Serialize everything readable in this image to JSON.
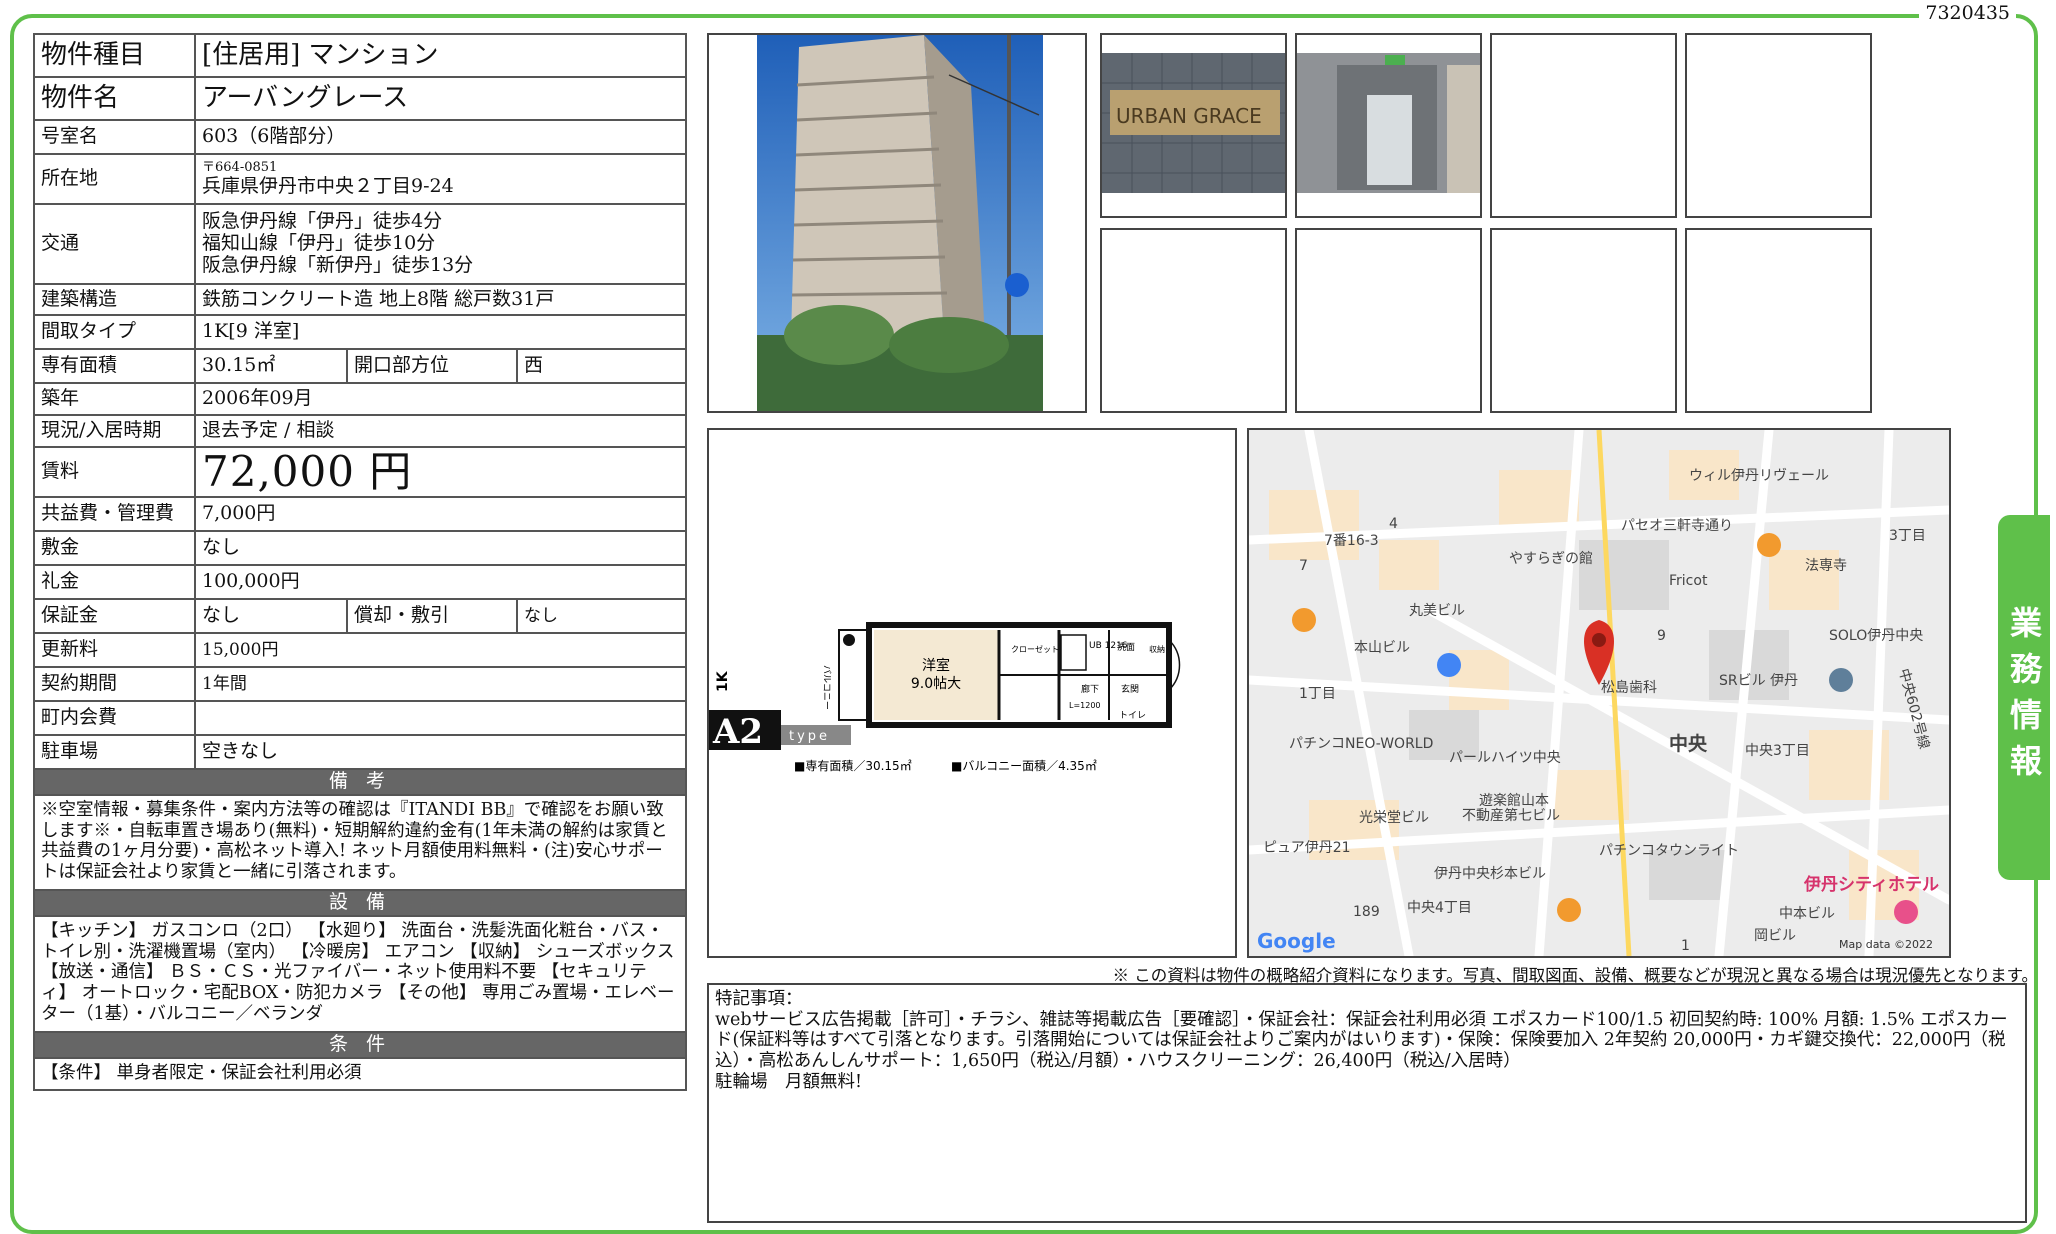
{
  "doc_id": "7320435",
  "side_tab": "業務情報",
  "property": {
    "type_label": "物件種目",
    "type_value": "[住居用]  マンション",
    "name_label": "物件名",
    "name_value": "アーバングレース",
    "room_label": "号室名",
    "room_value": "603（6階部分）",
    "address_label": "所在地",
    "postal": "〒664-0851",
    "address": "兵庫県伊丹市中央２丁目9-24",
    "access_label": "交通",
    "access": [
      "阪急伊丹線「伊丹」徒歩4分",
      "福知山線「伊丹」徒歩10分",
      "阪急伊丹線「新伊丹」徒歩13分"
    ],
    "structure_label": "建築構造",
    "structure_value": "鉄筋コンクリート造 地上8階 総戸数31戸",
    "layout_label": "間取タイプ",
    "layout_value": "1K[9 洋室]",
    "area_label": "専有面積",
    "area_value": "30.15㎡",
    "direction_label": "開口部方位",
    "direction_value": "西",
    "built_label": "築年",
    "built_value": "2006年09月",
    "status_label": "現況/入居時期",
    "status_value": "退去予定 / 相談",
    "rent_label": "賃料",
    "rent_value": "72,000 円",
    "fee_label": "共益費・管理費",
    "fee_value": "7,000円",
    "deposit_label": "敷金",
    "deposit_value": "なし",
    "key_money_label": "礼金",
    "key_money_value": "100,000円",
    "guarantee_label": "保証金",
    "guarantee_value": "なし",
    "amort_label": "償却・敷引",
    "amort_value": "なし",
    "renewal_label": "更新料",
    "renewal_value": "15,000円",
    "term_label": "契約期間",
    "term_value": "1年間",
    "town_fee_label": "町内会費",
    "town_fee_value": "",
    "parking_label": "駐車場",
    "parking_value": "空きなし"
  },
  "remarks": {
    "title": "備 考",
    "text": "※空室情報・募集条件・案内方法等の確認は『ITANDI BB』で確認をお願い致します※・自転車置き場あり(無料)・短期解約違約金有(1年未満の解約は家賃と共益費の1ヶ月分要)・高松ネット導入! ネット月額使用料無料・(注)安心サポートは保証会社より家賃と一緒に引落されます。"
  },
  "equipment": {
    "title": "設 備",
    "text": "【キッチン】 ガスコンロ（2口） 【水廻り】 洗面台・洗髪洗面化粧台・バス・トイレ別・洗濯機置場（室内） 【冷暖房】 エアコン 【収納】 シューズボックス 【放送・通信】 ＢＳ・ＣＳ・光ファイバー・ネット使用料不要 【セキュリティ】 オートロック・宅配BOX・防犯カメラ 【その他】 専用ごみ置場・エレベーター（1基）・バルコニー／ベランダ"
  },
  "conditions": {
    "title": "条 件",
    "text": "【条件】 単身者限定・保証会社利用必須"
  },
  "photos": {
    "entrance_sign": "URBAN GRACE"
  },
  "floorplan": {
    "type_badge": "A2",
    "type_word": "type",
    "kind": "1K",
    "room_label": "洋室",
    "room_size": "9.0帖大",
    "balcony": "バルコニー",
    "closet": "クローゼット",
    "ub": "UB 1216",
    "wash": "洗面",
    "hall": "廊下",
    "entrance": "玄関",
    "toilet": "トイレ",
    "storage": "収納",
    "area_text": "■専有面積／30.15㎡",
    "balcony_text": "■バルコニー面積／4.35㎡",
    "dim": "L=1200"
  },
  "map": {
    "labels": [
      "ウィル伊丹リヴェール",
      "パセオ三軒寺通り",
      "3丁目",
      "4",
      "7番16-3",
      "7",
      "やすらぎの館",
      "Fricot",
      "法専寺",
      "丸美ビル",
      "本山ビル",
      "9",
      "SOLO伊丹中央",
      "SRビル 伊丹",
      "1丁目",
      "松島歯科",
      "中央602号線",
      "パチンコNEO-WORLD",
      "パールハイツ中央",
      "中央",
      "中央3丁目",
      "遊楽館山本",
      "不動産第七ビル",
      "光栄堂ビル",
      "ピュア伊丹21",
      "パチンコタウンライト",
      "伊丹中央杉本ビル",
      "伊丹シティホテル",
      "189",
      "中央4丁目",
      "中本ビル",
      "岡ビル",
      "1"
    ],
    "logo": "Google",
    "credit": "Map data ©2022"
  },
  "disclaimer": "※ この資料は物件の概略紹介資料になります。写真、間取図面、設備、概要などが現況と異なる場合は現況優先となります。",
  "special_notes": {
    "title": "特記事項：",
    "line1": "webサービス広告掲載［許可］・チラシ、雑誌等掲載広告［要確認］・保証会社：保証会社利用必須 エポスカード100/1.5 初回契約時: 100% 月額: 1.5% エポスカード(保証料等はすべて引落となります。引落開始については保証会社よりご案内がはいります)・保険：保険要加入 2年契約 20,000円・カギ鍵交換代：22,000円（税込）・高松あんしんサポート：1,650円（税込/月額）・ハウスクリーニング：26,400円（税込/入居時）",
    "line2": "駐輪場　月額無料!"
  }
}
